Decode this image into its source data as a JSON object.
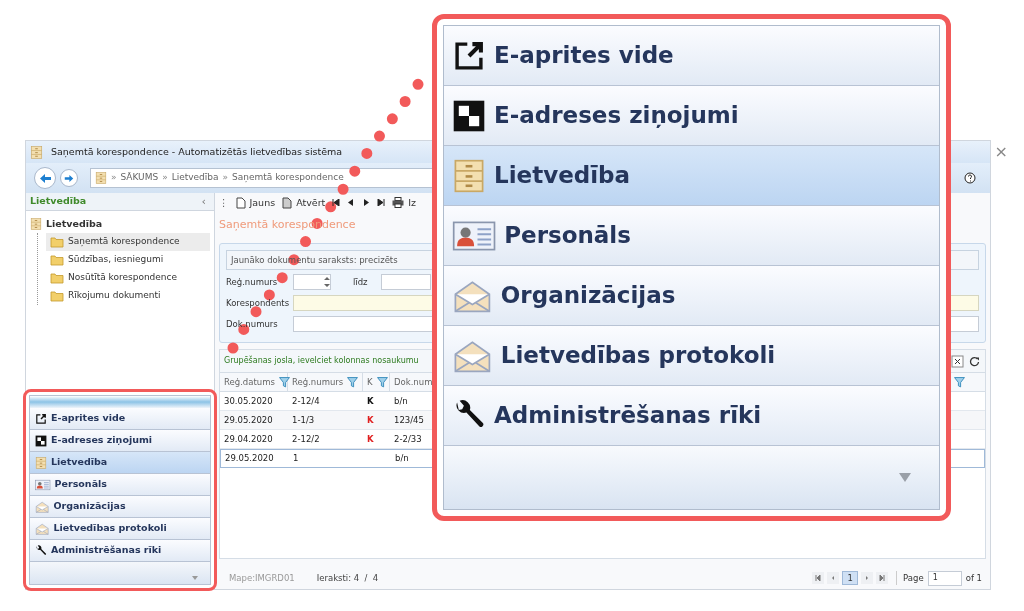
{
  "window": {
    "title": "Saņemtā korespondence - Automatizētās lietvedības sistēma",
    "close": "×"
  },
  "breadcrumb": {
    "separator": "»",
    "items": [
      "SĀKUMS",
      "Lietvedība",
      "Saņemtā korespondence"
    ]
  },
  "left_panel": {
    "title": "Lietvedība",
    "collapse": "‹",
    "tree": [
      {
        "label": "Lietvedība",
        "expanded": true,
        "children": [
          {
            "label": "Saņemtā korespondence",
            "selected": true
          },
          {
            "label": "Sūdzības, iesniegumi",
            "selected": false
          },
          {
            "label": "Nosūtītā korespondence",
            "selected": false
          },
          {
            "label": "Rīkojumu dokumenti",
            "selected": false
          }
        ]
      }
    ]
  },
  "nav_menu": {
    "items": [
      {
        "label": "E-aprites vide",
        "selected": false
      },
      {
        "label": "E-adreses ziņojumi",
        "selected": false
      },
      {
        "label": "Lietvedība",
        "selected": true
      },
      {
        "label": "Personāls",
        "selected": false
      },
      {
        "label": "Organizācijas",
        "selected": false
      },
      {
        "label": "Lietvedības protokoli",
        "selected": false
      },
      {
        "label": "Administrēšanas rīki",
        "selected": false
      }
    ]
  },
  "toolbar": {
    "grip": "⋮",
    "buttons": [
      "Jauns",
      "Atvērt"
    ],
    "print_label": "Iz"
  },
  "page_title": "Saņemtā korespondence",
  "filter": {
    "notice": "Jaunāko dokumentu saraksts: precizēts",
    "reg_label": "Reģ.numurs",
    "to_label": "līdz",
    "correspondent_label": "Korespondents",
    "doc_label": "Dok.numurs"
  },
  "grid": {
    "group_hint": "Grupēšanas josla, ievelciet kolonnas nosaukumu",
    "columns": [
      "Reģ.datums",
      "Reģ.numurs",
      "K",
      "Dok.num"
    ],
    "rows": [
      {
        "date": "30.05.2020",
        "number": "2-12/4",
        "k": "K",
        "color": "#111111",
        "doc": "b/n",
        "selected": false
      },
      {
        "date": "29.05.2020",
        "number": "1-1/3",
        "k": "K",
        "color": "#e02020",
        "doc": "123/45",
        "selected": false
      },
      {
        "date": "29.04.2020",
        "number": "2-12/2",
        "k": "K",
        "color": "#e02020",
        "doc": "2-2/33",
        "selected": false
      },
      {
        "date": "29.05.2020",
        "number": "1",
        "doc": "b/n",
        "selected": true
      }
    ]
  },
  "footer": {
    "folder": "Mape:IMGRD01",
    "records": "Ieraksti: 4  /  4",
    "page_current": "1",
    "page_label": "Page",
    "page_value": "1",
    "page_total": "of 1"
  },
  "callout": {
    "items": [
      {
        "label": "E-aprites vide",
        "selected": false
      },
      {
        "label": "E-adreses ziņojumi",
        "selected": false
      },
      {
        "label": "Lietvedība",
        "selected": true
      },
      {
        "label": "Personāls",
        "selected": false
      },
      {
        "label": "Organizācijas",
        "selected": false
      },
      {
        "label": "Lietvedības protokoli",
        "selected": false
      },
      {
        "label": "Administrēšanas rīki",
        "selected": false
      }
    ]
  }
}
